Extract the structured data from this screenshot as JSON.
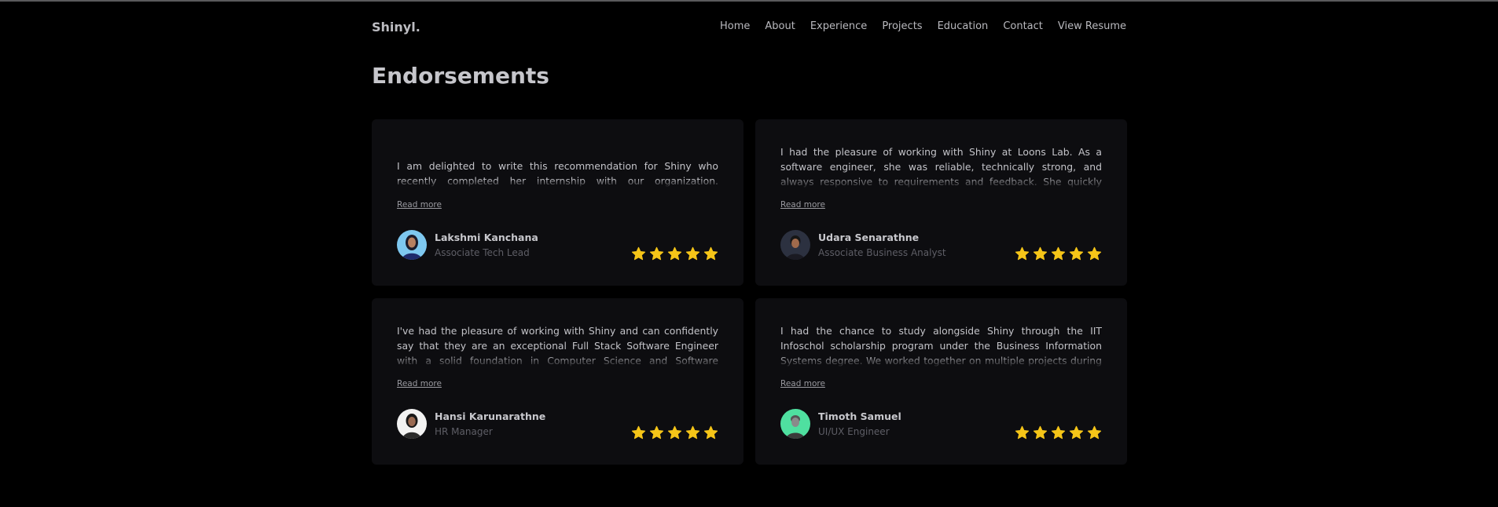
{
  "nav": {
    "logo": "Shinyl.",
    "items": [
      {
        "label": "Home"
      },
      {
        "label": "About"
      },
      {
        "label": "Experience"
      },
      {
        "label": "Projects"
      },
      {
        "label": "Education"
      },
      {
        "label": "Contact"
      },
      {
        "label": "View Resume"
      }
    ]
  },
  "section": {
    "title": "Endorsements"
  },
  "colors": {
    "star": "#f5c518",
    "card": "#0d0d10",
    "background": "#000000"
  },
  "read_more_label": "Read more",
  "endorsements": [
    {
      "quote": "I am delighted to write this recommendation for Shiny who recently completed her internship with our organization. Throughout her ti…",
      "name": "Lakshmi Kanchana",
      "role": "Associate Tech Lead",
      "rating": 5
    },
    {
      "quote": "I had the pleasure of working with Shiny at Loons Lab. As a software engineer, she was reliable, technically strong, and always responsive to requirements and feedback. She quickly understood business nee…",
      "name": "Udara Senarathne",
      "role": "Associate Business Analyst",
      "rating": 5
    },
    {
      "quote": "I've had the pleasure of working with Shiny and can confidently say that they are an exceptional Full Stack Software Engineer with a solid foundation in Computer Science and Software Engineering. Their abili…",
      "name": "Hansi Karunarathne",
      "role": "HR Manager",
      "rating": 5
    },
    {
      "quote": "I had the chance to study alongside Shiny through the IIT Infoschol scholarship program under the Business Information Systems degree. We worked together on multiple projects during that time, and I w…",
      "name": "Timoth Samuel",
      "role": "UI/UX Engineer",
      "rating": 5
    }
  ]
}
